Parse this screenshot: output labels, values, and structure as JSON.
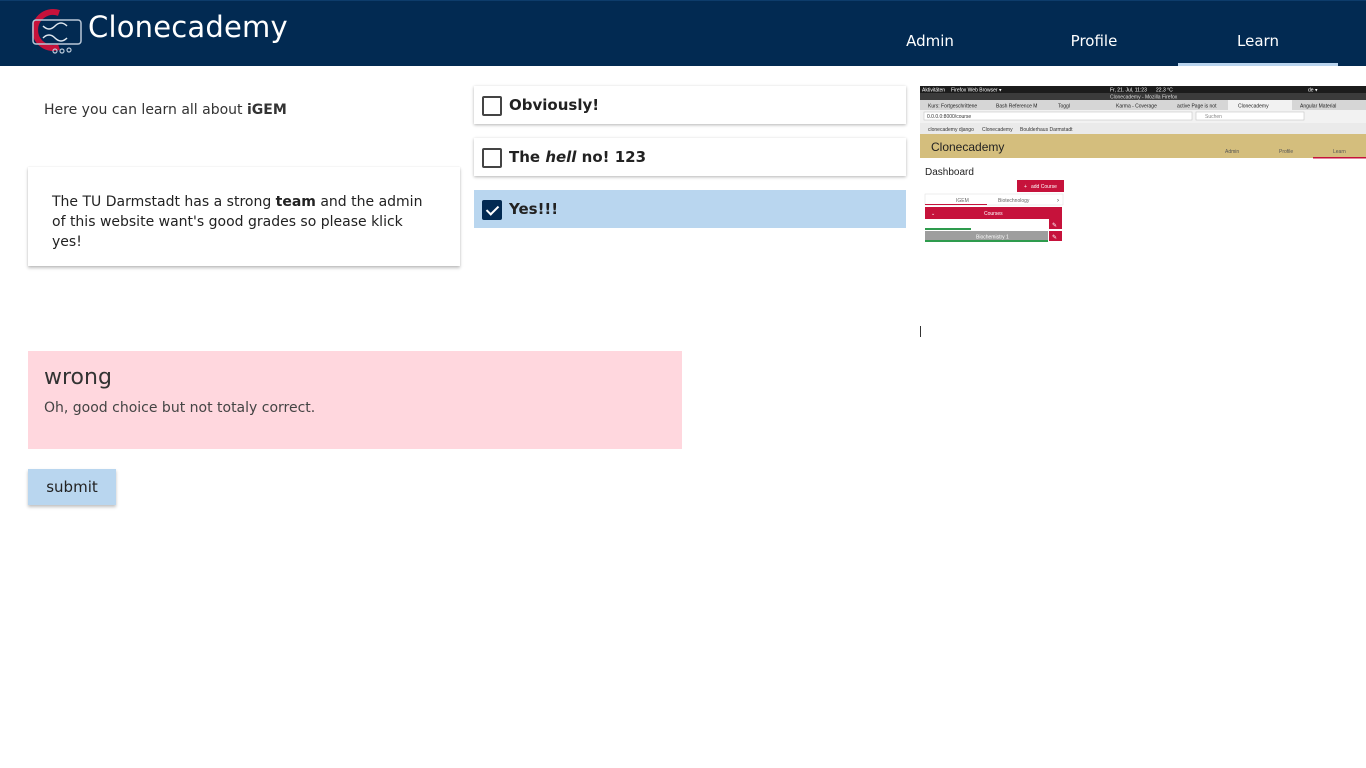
{
  "header": {
    "brand": "Clonecademy",
    "tabs": [
      {
        "label": "Admin"
      },
      {
        "label": "Profile"
      },
      {
        "label": "Learn",
        "active": true
      }
    ]
  },
  "intro": {
    "prefix": "Here you can learn all about ",
    "highlight": "iGEM"
  },
  "question": {
    "part1": "The TU Darmstadt has a strong ",
    "bold": "team",
    "part2": " and the admin of this website want's good grades so please klick yes!"
  },
  "answers": [
    {
      "label": "Obviously!",
      "checked": false
    },
    {
      "label_pre": "The ",
      "label_em": "hell",
      "label_post": " no! 123",
      "checked": false
    },
    {
      "label": "Yes!!!",
      "checked": true
    }
  ],
  "feedback": {
    "title": "wrong",
    "text": "Oh, good choice but not totaly correct."
  },
  "submit_label": "submit",
  "embedded_screenshot": {
    "top_bar": {
      "left": "Aktivitäten",
      "app": "Firefox Web Browser ▾",
      "clock": "Fr, 21. Jul, 11:23",
      "weather": "22.3 °C",
      "lang": "de ▾"
    },
    "window_title": "Clonecademy - Mozilla Firefox",
    "tabs": [
      "Kurs: Fortgeschrittene",
      "Bash Reference M",
      "Toggl",
      "Karma - Coverage",
      "active Page is not",
      "Clonecademy",
      "Angular Material"
    ],
    "url": "0.0.0.0:8000/course",
    "search_placeholder": "Suchen",
    "bookmarks": [
      "clonecademy django",
      "Clonecademy",
      "Boulderhaus Darmstadt"
    ],
    "app_brand": "Clonecademy",
    "app_tabs": [
      "Admin",
      "Profile",
      "Learn"
    ],
    "dashboard": "Dashboard",
    "add_course": "add Course",
    "category_tabs": [
      "IGEM",
      "Biotechnology"
    ],
    "courses_header": "Courses",
    "course_item": "Biochemistry 1",
    "colors": {
      "app_header": "#d4be7d",
      "accent": "#c6123b"
    }
  },
  "colors": {
    "nav": "#022a52",
    "selected": "#b9d6ef",
    "error_bg": "#ffd7de"
  }
}
